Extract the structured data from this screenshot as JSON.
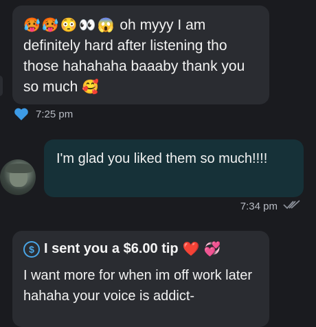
{
  "colors": {
    "background": "#1a1b1f",
    "incoming_bubble": "#2a2c31",
    "outgoing_bubble": "#163138",
    "accent": "#4aa7e8"
  },
  "messages": [
    {
      "emojis": [
        "🥵",
        "🥵",
        "😳",
        "👀",
        "😱"
      ],
      "text": "oh myyy I am definitely hard after listening tho those hahahaha baaaby thank you so much",
      "trailing_emoji": "🥰",
      "time": "7:25 pm",
      "liked_icon": "heart-icon"
    },
    {
      "text": "I'm glad you liked them so much!!!!",
      "time": "7:34 pm",
      "read_icon": "double-check-icon"
    },
    {
      "tip_label": "I sent you a $6.00 tip",
      "tip_emojis": [
        "❤️",
        "💞"
      ],
      "text": "I want more for when im off work later hahaha your voice is addict-"
    }
  ]
}
